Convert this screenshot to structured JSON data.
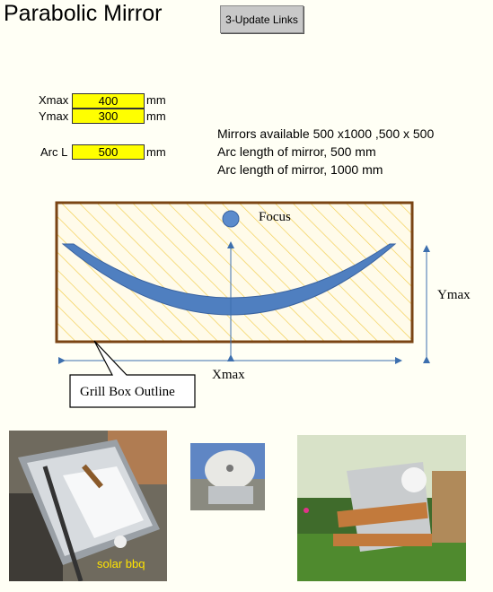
{
  "header": {
    "title": "Parabolic Mirror",
    "update_button": "3-Update Links"
  },
  "inputs": {
    "xmax": {
      "label": "Xmax",
      "value": "400",
      "unit": "mm"
    },
    "ymax": {
      "label": "Ymax",
      "value": "300",
      "unit": "mm"
    },
    "arcl": {
      "label": "Arc L",
      "value": "500",
      "unit": "mm"
    }
  },
  "info": {
    "line1": "Mirrors available 500 x1000 ,500 x 500",
    "line2": "Arc length of mirror, 500 mm",
    "line3": "Arc length of mirror, 1000 mm"
  },
  "diagram": {
    "focus_label": "Focus",
    "ymax_label": "Ymax",
    "xmax_label": "Xmax",
    "callout": "Grill Box Outline"
  },
  "photos": {
    "left_caption": "solar bbq"
  },
  "colors": {
    "input_bg": "#ffff00",
    "box_border": "#7a4414",
    "hatch": "#f2cc4a",
    "mirror": "#4f7fc0",
    "arrow": "#3d6fae"
  }
}
